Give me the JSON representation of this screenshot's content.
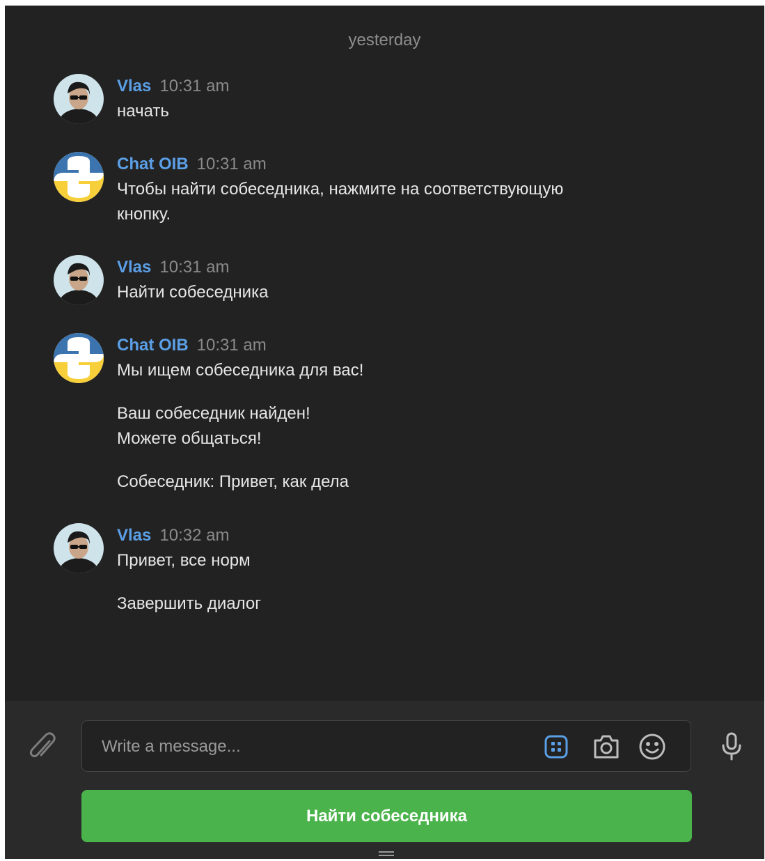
{
  "chat": {
    "date_separator": "yesterday",
    "messages": [
      {
        "author": "Vlas",
        "time": "10:31 am",
        "avatar": "user-photo-avatar",
        "paragraphs": [
          [
            "начать"
          ]
        ]
      },
      {
        "author": "Chat OIB",
        "time": "10:31 am",
        "avatar": "python-logo-avatar",
        "paragraphs": [
          [
            "Чтобы найти собеседника, нажмите на соответствующую",
            "кнопку."
          ]
        ]
      },
      {
        "author": "Vlas",
        "time": "10:31 am",
        "avatar": "user-photo-avatar",
        "paragraphs": [
          [
            "Найти собеседника"
          ]
        ]
      },
      {
        "author": "Chat OIB",
        "time": "10:31 am",
        "avatar": "python-logo-avatar",
        "paragraphs": [
          [
            "Мы ищем собеседника для вас!"
          ],
          [
            "Ваш собеседник найден!",
            "Можете общаться!"
          ],
          [
            "Собеседник: Привет, как дела"
          ]
        ]
      },
      {
        "author": "Vlas",
        "time": "10:32 am",
        "avatar": "user-photo-avatar",
        "paragraphs": [
          [
            "Привет, все норм"
          ],
          [
            "Завершить диалог"
          ]
        ]
      }
    ]
  },
  "composer": {
    "placeholder": "Write a message...",
    "icons": [
      "paperclip-icon",
      "bot-keyboard-icon",
      "camera-icon",
      "emoji-icon",
      "microphone-icon"
    ],
    "accent_color": "#5b9fe6"
  },
  "keyboard": {
    "button_label": "Найти собеседника",
    "button_color": "#4bb34b"
  }
}
